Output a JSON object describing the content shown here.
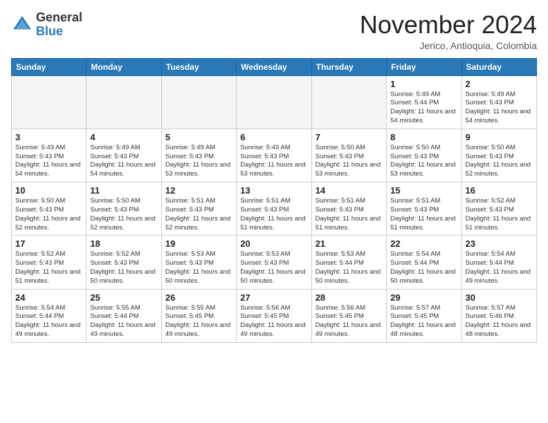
{
  "header": {
    "logo": {
      "general": "General",
      "blue": "Blue"
    },
    "title": "November 2024",
    "location": "Jerico, Antioquia, Colombia"
  },
  "days_of_week": [
    "Sunday",
    "Monday",
    "Tuesday",
    "Wednesday",
    "Thursday",
    "Friday",
    "Saturday"
  ],
  "weeks": [
    [
      {
        "day": "",
        "empty": true
      },
      {
        "day": "",
        "empty": true
      },
      {
        "day": "",
        "empty": true
      },
      {
        "day": "",
        "empty": true
      },
      {
        "day": "",
        "empty": true
      },
      {
        "day": "1",
        "sunrise": "5:49 AM",
        "sunset": "5:44 PM",
        "daylight": "11 hours and 54 minutes."
      },
      {
        "day": "2",
        "sunrise": "5:49 AM",
        "sunset": "5:43 PM",
        "daylight": "11 hours and 54 minutes."
      }
    ],
    [
      {
        "day": "3",
        "sunrise": "5:49 AM",
        "sunset": "5:43 PM",
        "daylight": "11 hours and 54 minutes."
      },
      {
        "day": "4",
        "sunrise": "5:49 AM",
        "sunset": "5:43 PM",
        "daylight": "11 hours and 54 minutes."
      },
      {
        "day": "5",
        "sunrise": "5:49 AM",
        "sunset": "5:43 PM",
        "daylight": "11 hours and 53 minutes."
      },
      {
        "day": "6",
        "sunrise": "5:49 AM",
        "sunset": "5:43 PM",
        "daylight": "11 hours and 53 minutes."
      },
      {
        "day": "7",
        "sunrise": "5:50 AM",
        "sunset": "5:43 PM",
        "daylight": "11 hours and 53 minutes."
      },
      {
        "day": "8",
        "sunrise": "5:50 AM",
        "sunset": "5:43 PM",
        "daylight": "11 hours and 53 minutes."
      },
      {
        "day": "9",
        "sunrise": "5:50 AM",
        "sunset": "5:43 PM",
        "daylight": "11 hours and 52 minutes."
      }
    ],
    [
      {
        "day": "10",
        "sunrise": "5:50 AM",
        "sunset": "5:43 PM",
        "daylight": "11 hours and 52 minutes."
      },
      {
        "day": "11",
        "sunrise": "5:50 AM",
        "sunset": "5:43 PM",
        "daylight": "11 hours and 52 minutes."
      },
      {
        "day": "12",
        "sunrise": "5:51 AM",
        "sunset": "5:43 PM",
        "daylight": "11 hours and 52 minutes."
      },
      {
        "day": "13",
        "sunrise": "5:51 AM",
        "sunset": "5:43 PM",
        "daylight": "11 hours and 51 minutes."
      },
      {
        "day": "14",
        "sunrise": "5:51 AM",
        "sunset": "5:43 PM",
        "daylight": "11 hours and 51 minutes."
      },
      {
        "day": "15",
        "sunrise": "5:51 AM",
        "sunset": "5:43 PM",
        "daylight": "11 hours and 51 minutes."
      },
      {
        "day": "16",
        "sunrise": "5:52 AM",
        "sunset": "5:43 PM",
        "daylight": "11 hours and 51 minutes."
      }
    ],
    [
      {
        "day": "17",
        "sunrise": "5:52 AM",
        "sunset": "5:43 PM",
        "daylight": "11 hours and 51 minutes."
      },
      {
        "day": "18",
        "sunrise": "5:52 AM",
        "sunset": "5:43 PM",
        "daylight": "11 hours and 50 minutes."
      },
      {
        "day": "19",
        "sunrise": "5:53 AM",
        "sunset": "5:43 PM",
        "daylight": "11 hours and 50 minutes."
      },
      {
        "day": "20",
        "sunrise": "5:53 AM",
        "sunset": "5:43 PM",
        "daylight": "11 hours and 50 minutes."
      },
      {
        "day": "21",
        "sunrise": "5:53 AM",
        "sunset": "5:44 PM",
        "daylight": "11 hours and 50 minutes."
      },
      {
        "day": "22",
        "sunrise": "5:54 AM",
        "sunset": "5:44 PM",
        "daylight": "11 hours and 50 minutes."
      },
      {
        "day": "23",
        "sunrise": "5:54 AM",
        "sunset": "5:44 PM",
        "daylight": "11 hours and 49 minutes."
      }
    ],
    [
      {
        "day": "24",
        "sunrise": "5:54 AM",
        "sunset": "5:44 PM",
        "daylight": "11 hours and 49 minutes."
      },
      {
        "day": "25",
        "sunrise": "5:55 AM",
        "sunset": "5:44 PM",
        "daylight": "11 hours and 49 minutes."
      },
      {
        "day": "26",
        "sunrise": "5:55 AM",
        "sunset": "5:45 PM",
        "daylight": "11 hours and 49 minutes."
      },
      {
        "day": "27",
        "sunrise": "5:56 AM",
        "sunset": "5:45 PM",
        "daylight": "11 hours and 49 minutes."
      },
      {
        "day": "28",
        "sunrise": "5:56 AM",
        "sunset": "5:45 PM",
        "daylight": "11 hours and 49 minutes."
      },
      {
        "day": "29",
        "sunrise": "5:57 AM",
        "sunset": "5:45 PM",
        "daylight": "11 hours and 48 minutes."
      },
      {
        "day": "30",
        "sunrise": "5:57 AM",
        "sunset": "5:46 PM",
        "daylight": "11 hours and 48 minutes."
      }
    ]
  ]
}
